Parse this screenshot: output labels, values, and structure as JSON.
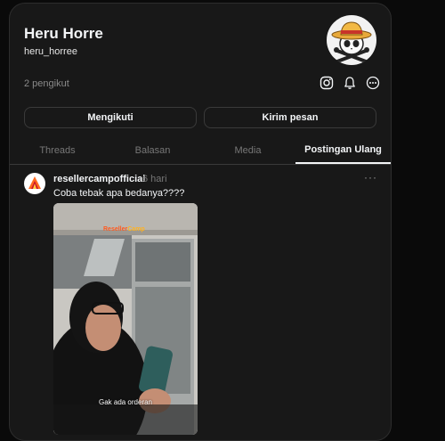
{
  "profile": {
    "name": "Heru Horre",
    "handle": "heru_horree",
    "followers": "2 pengikut"
  },
  "header_icons": [
    "instagram-icon",
    "bell-icon",
    "more-circle-icon"
  ],
  "actions": {
    "follow": "Mengikuti",
    "message": "Kirim pesan"
  },
  "tabs": [
    {
      "label": "Threads",
      "active": false
    },
    {
      "label": "Balasan",
      "active": false
    },
    {
      "label": "Media",
      "active": false
    },
    {
      "label": "Postingan Ulang",
      "active": true
    }
  ],
  "post": {
    "author": "resellercampofficial",
    "time": "6 hari",
    "more": "···",
    "caption": "Coba tebak apa bedanya????",
    "media_subtitle": "Gak ada orderan",
    "watermark_a": "Reseller",
    "watermark_b": "Camp"
  },
  "colors": {
    "background": "#0a0a0a",
    "card": "#181818",
    "border": "#2d2d2d",
    "text": "#f3f5f7",
    "muted": "#777777"
  }
}
